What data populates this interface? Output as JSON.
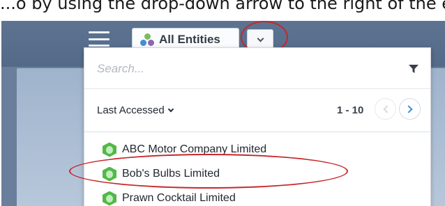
{
  "caption": "...o by using the drop-down arrow to the right of the entity switcher where applicable...",
  "header": {
    "entity_switcher_label": "All Entities"
  },
  "dropdown": {
    "search_placeholder": "Search...",
    "sort_label": "Last Accessed",
    "range": "1 - 10",
    "entities": [
      "ABC Motor Company Limited",
      "Bob's Bulbs Limited",
      "Prawn Cocktail Limited"
    ]
  },
  "colors": {
    "appbar": "#536a88",
    "entity_icon": "#52b947",
    "annotation_red": "#c7262b",
    "pager_active": "#3d8fd8"
  },
  "icons": {
    "menu": "hamburger-icon",
    "entity_switcher": "entity-cluster-icon",
    "dropdown_arrow": "chevron-down-icon",
    "filter": "filter-icon",
    "prev": "chevron-left-icon",
    "next": "chevron-right-icon",
    "entity": "hexagon-entity-icon"
  }
}
